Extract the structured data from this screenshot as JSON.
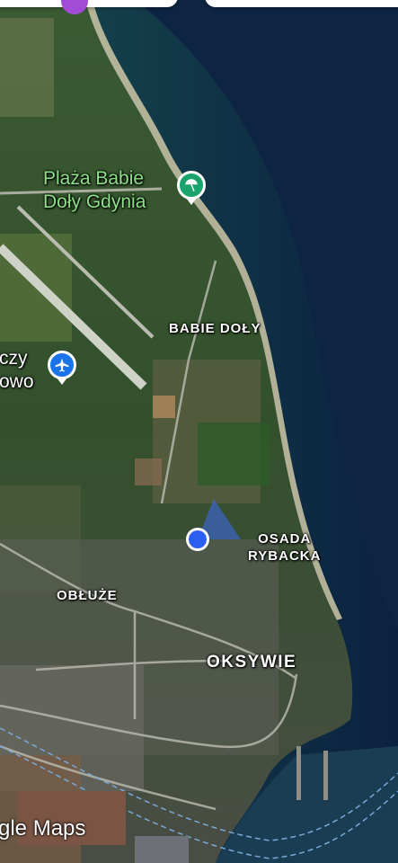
{
  "map": {
    "type": "satellite",
    "colors": {
      "sea_deep": "#0e2340",
      "sea_shallow": "#1e6a5e",
      "land": "#2f4a2c",
      "beach": "#cfc8a6",
      "location_dot": "#2b5ff0",
      "poi_green": "#1aa36b",
      "poi_blue": "#1a73e8"
    }
  },
  "pois": {
    "beach": {
      "name_line1": "Plaża Babie",
      "name_line2": "Doły Gdynia",
      "icon": "beach-umbrella-icon"
    },
    "airport": {
      "name_line1": "czy",
      "name_line2": "owo",
      "icon": "airplane-icon"
    }
  },
  "places": {
    "babie_doly": "BABIE DOŁY",
    "osada_line1": "OSADA",
    "osada_line2": "RYBACKA",
    "obluze": "OBŁUŻE",
    "oksywie": "OKSYWIE"
  },
  "attribution": {
    "brand": "gle Maps"
  }
}
